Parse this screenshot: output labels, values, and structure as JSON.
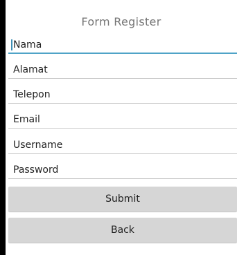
{
  "form": {
    "title": "Form Register",
    "fields": [
      {
        "placeholder": "Nama",
        "value": ""
      },
      {
        "placeholder": "Alamat",
        "value": ""
      },
      {
        "placeholder": "Telepon",
        "value": ""
      },
      {
        "placeholder": "Email",
        "value": ""
      },
      {
        "placeholder": "Username",
        "value": ""
      },
      {
        "placeholder": "Password",
        "value": ""
      }
    ],
    "submit_label": "Submit",
    "back_label": "Back"
  },
  "colors": {
    "focus_underline": "#4fa3c7",
    "button_background": "#d6d6d6",
    "title_text": "#757575"
  }
}
